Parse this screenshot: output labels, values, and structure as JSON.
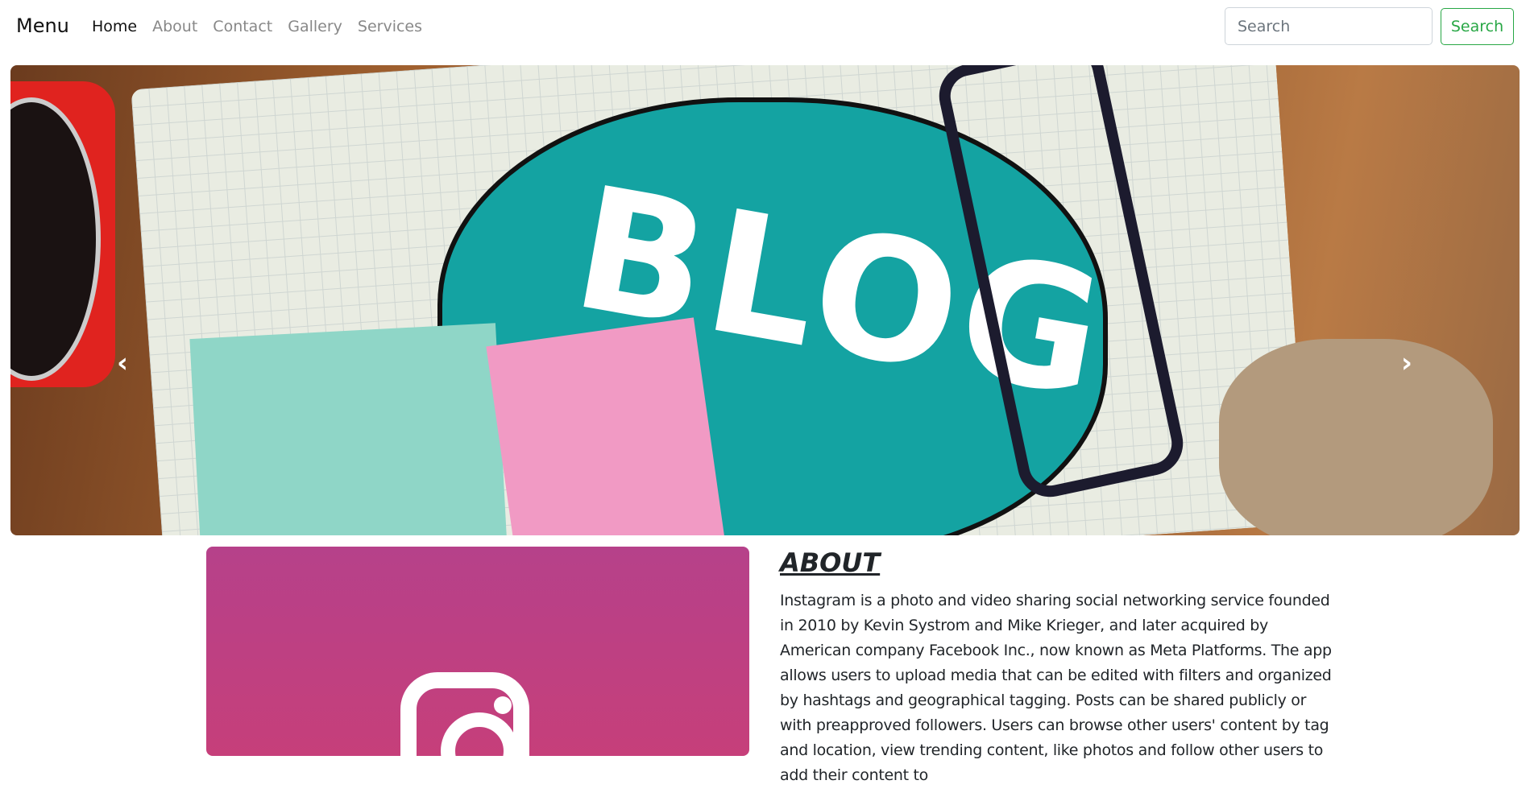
{
  "nav": {
    "brand": "Menu",
    "links": [
      {
        "label": "Home",
        "active": true
      },
      {
        "label": "About"
      },
      {
        "label": "Contact"
      },
      {
        "label": "Gallery"
      },
      {
        "label": "Services"
      }
    ],
    "search_placeholder": "Search",
    "search_button": "Search",
    "accent_color": "#28a745"
  },
  "carousel": {
    "slide_text": "BLOG",
    "prev_icon": "chevron-left-icon",
    "next_icon": "chevron-right-icon",
    "prev_glyph": "‹",
    "next_glyph": "›"
  },
  "about": {
    "image_icon": "instagram-logo",
    "title": "ABOUT",
    "text": "Instagram is a photo and video sharing social networking service founded in 2010 by Kevin Systrom and Mike Krieger, and later acquired by American company Facebook Inc., now known as Meta Platforms. The app allows users to upload media that can be edited with filters and organized by hashtags and geographical tagging. Posts can be shared publicly or with preapproved followers. Users can browse other users' content by tag and location, view trending content, like photos and follow other users to add their content to"
  }
}
